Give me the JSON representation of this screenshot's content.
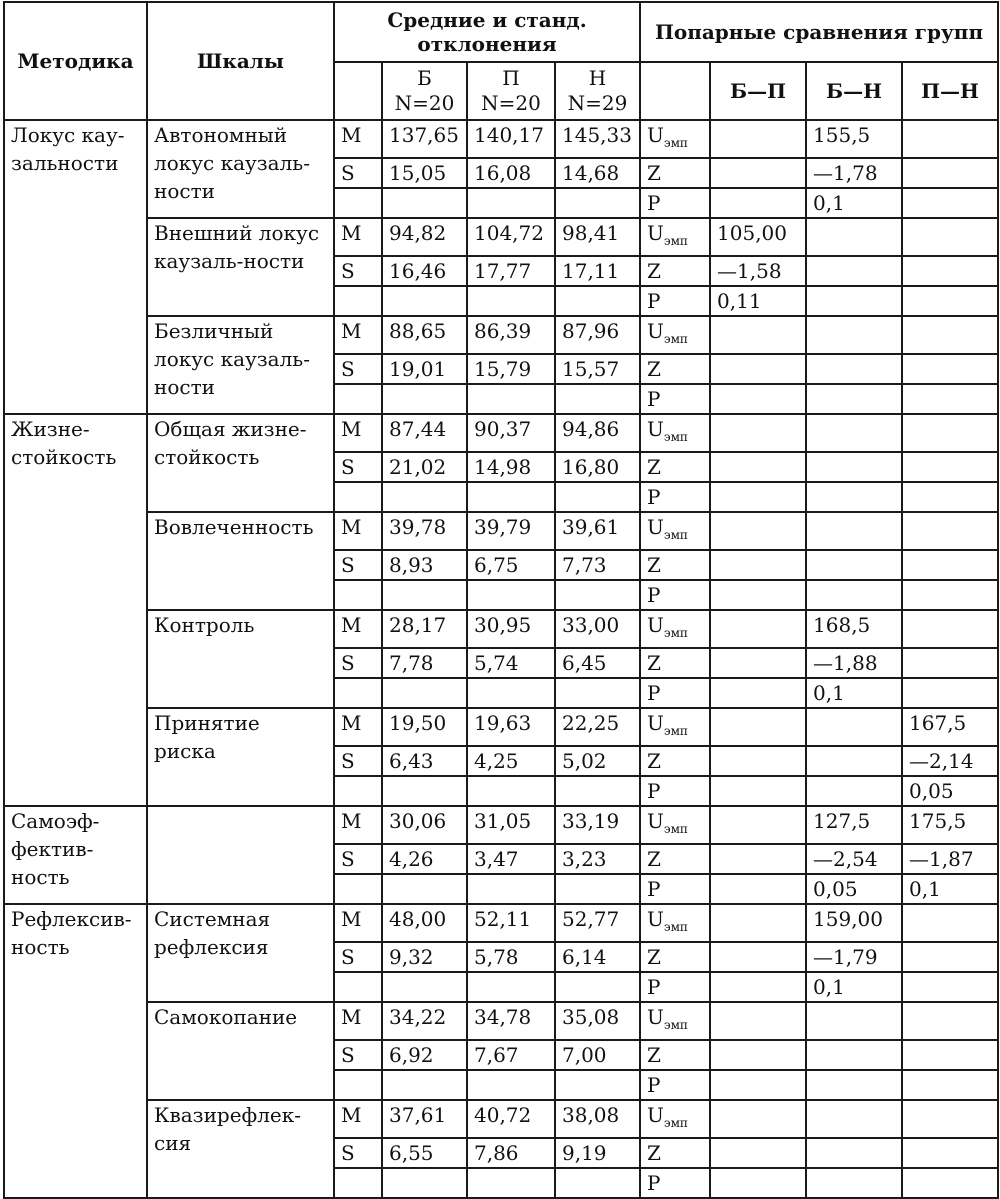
{
  "header": {
    "methodology": "Методика",
    "scales": "Шкалы",
    "means_title": "Средние и станд. отклонения",
    "comparisons_title": "Попарные сравнения групп",
    "groups": [
      {
        "letter": "Б",
        "n": "N=20"
      },
      {
        "letter": "П",
        "n": "N=20"
      },
      {
        "letter": "Н",
        "n": "N=29"
      }
    ],
    "pairs": [
      "Б—П",
      "Б—Н",
      "П—Н"
    ]
  },
  "stat_labels": [
    "M",
    "S",
    ""
  ],
  "test_labels": [
    {
      "main": "U",
      "sub": "эмп"
    },
    {
      "main": "Z",
      "sub": ""
    },
    {
      "main": "P",
      "sub": ""
    }
  ],
  "sections": [
    {
      "method": "Локус кау-зальности",
      "scales": [
        {
          "name": "Автономный локус каузаль-ности",
          "values": [
            [
              "137,65",
              "140,17",
              "145,33"
            ],
            [
              "15,05",
              "16,08",
              "14,68"
            ],
            [
              "",
              "",
              ""
            ]
          ],
          "pairs": [
            [
              "",
              "155,5",
              ""
            ],
            [
              "",
              "—1,78",
              ""
            ],
            [
              "",
              "0,1",
              ""
            ]
          ]
        },
        {
          "name": "Внешний локус каузаль-ности",
          "values": [
            [
              "94,82",
              "104,72",
              "98,41"
            ],
            [
              "16,46",
              "17,77",
              "17,11"
            ],
            [
              "",
              "",
              ""
            ]
          ],
          "pairs": [
            [
              "105,00",
              "",
              ""
            ],
            [
              "—1,58",
              "",
              ""
            ],
            [
              "0,11",
              "",
              ""
            ]
          ]
        },
        {
          "name": "Безличный локус каузаль-ности",
          "values": [
            [
              "88,65",
              "86,39",
              "87,96"
            ],
            [
              "19,01",
              "15,79",
              "15,57"
            ],
            [
              "",
              "",
              ""
            ]
          ],
          "pairs": [
            [
              "",
              "",
              ""
            ],
            [
              "",
              "",
              ""
            ],
            [
              "",
              "",
              ""
            ]
          ]
        }
      ]
    },
    {
      "method": "Жизне-стойкость",
      "scales": [
        {
          "name": "Общая жизне-стойкость",
          "values": [
            [
              "87,44",
              "90,37",
              "94,86"
            ],
            [
              "21,02",
              "14,98",
              "16,80"
            ],
            [
              "",
              "",
              ""
            ]
          ],
          "pairs": [
            [
              "",
              "",
              ""
            ],
            [
              "",
              "",
              ""
            ],
            [
              "",
              "",
              ""
            ]
          ]
        },
        {
          "name": "Вовлеченность",
          "values": [
            [
              "39,78",
              "39,79",
              "39,61"
            ],
            [
              "8,93",
              "6,75",
              "7,73"
            ],
            [
              "",
              "",
              ""
            ]
          ],
          "pairs": [
            [
              "",
              "",
              ""
            ],
            [
              "",
              "",
              ""
            ],
            [
              "",
              "",
              ""
            ]
          ]
        },
        {
          "name": "Контроль",
          "values": [
            [
              "28,17",
              "30,95",
              "33,00"
            ],
            [
              "7,78",
              "5,74",
              "6,45"
            ],
            [
              "",
              "",
              ""
            ]
          ],
          "pairs": [
            [
              "",
              "168,5",
              ""
            ],
            [
              "",
              "—1,88",
              ""
            ],
            [
              "",
              "0,1",
              ""
            ]
          ]
        },
        {
          "name": "Принятие риска",
          "values": [
            [
              "19,50",
              "19,63",
              "22,25"
            ],
            [
              "6,43",
              "4,25",
              "5,02"
            ],
            [
              "",
              "",
              ""
            ]
          ],
          "pairs": [
            [
              "",
              "",
              "167,5"
            ],
            [
              "",
              "",
              "—2,14"
            ],
            [
              "",
              "",
              "0,05"
            ]
          ]
        }
      ]
    },
    {
      "method": "Самоэф-фектив-ность",
      "scales": [
        {
          "name": "",
          "values": [
            [
              "30,06",
              "31,05",
              "33,19"
            ],
            [
              "4,26",
              "3,47",
              "3,23"
            ],
            [
              "",
              "",
              ""
            ]
          ],
          "pairs": [
            [
              "",
              "127,5",
              "175,5"
            ],
            [
              "",
              "—2,54",
              "—1,87"
            ],
            [
              "",
              "0,05",
              "0,1"
            ]
          ]
        }
      ]
    },
    {
      "method": "Рефлексив-ность",
      "scales": [
        {
          "name": "Системная рефлексия",
          "values": [
            [
              "48,00",
              "52,11",
              "52,77"
            ],
            [
              "9,32",
              "5,78",
              "6,14"
            ],
            [
              "",
              "",
              ""
            ]
          ],
          "pairs": [
            [
              "",
              "159,00",
              ""
            ],
            [
              "",
              "—1,79",
              ""
            ],
            [
              "",
              "0,1",
              ""
            ]
          ]
        },
        {
          "name": "Самокопание",
          "values": [
            [
              "34,22",
              "34,78",
              "35,08"
            ],
            [
              "6,92",
              "7,67",
              "7,00"
            ],
            [
              "",
              "",
              ""
            ]
          ],
          "pairs": [
            [
              "",
              "",
              ""
            ],
            [
              "",
              "",
              ""
            ],
            [
              "",
              "",
              ""
            ]
          ]
        },
        {
          "name": "Квазирефлек-сия",
          "values": [
            [
              "37,61",
              "40,72",
              "38,08"
            ],
            [
              "6,55",
              "7,86",
              "9,19"
            ],
            [
              "",
              "",
              ""
            ]
          ],
          "pairs": [
            [
              "",
              "",
              ""
            ],
            [
              "",
              "",
              ""
            ],
            [
              "",
              "",
              ""
            ]
          ]
        }
      ]
    }
  ]
}
